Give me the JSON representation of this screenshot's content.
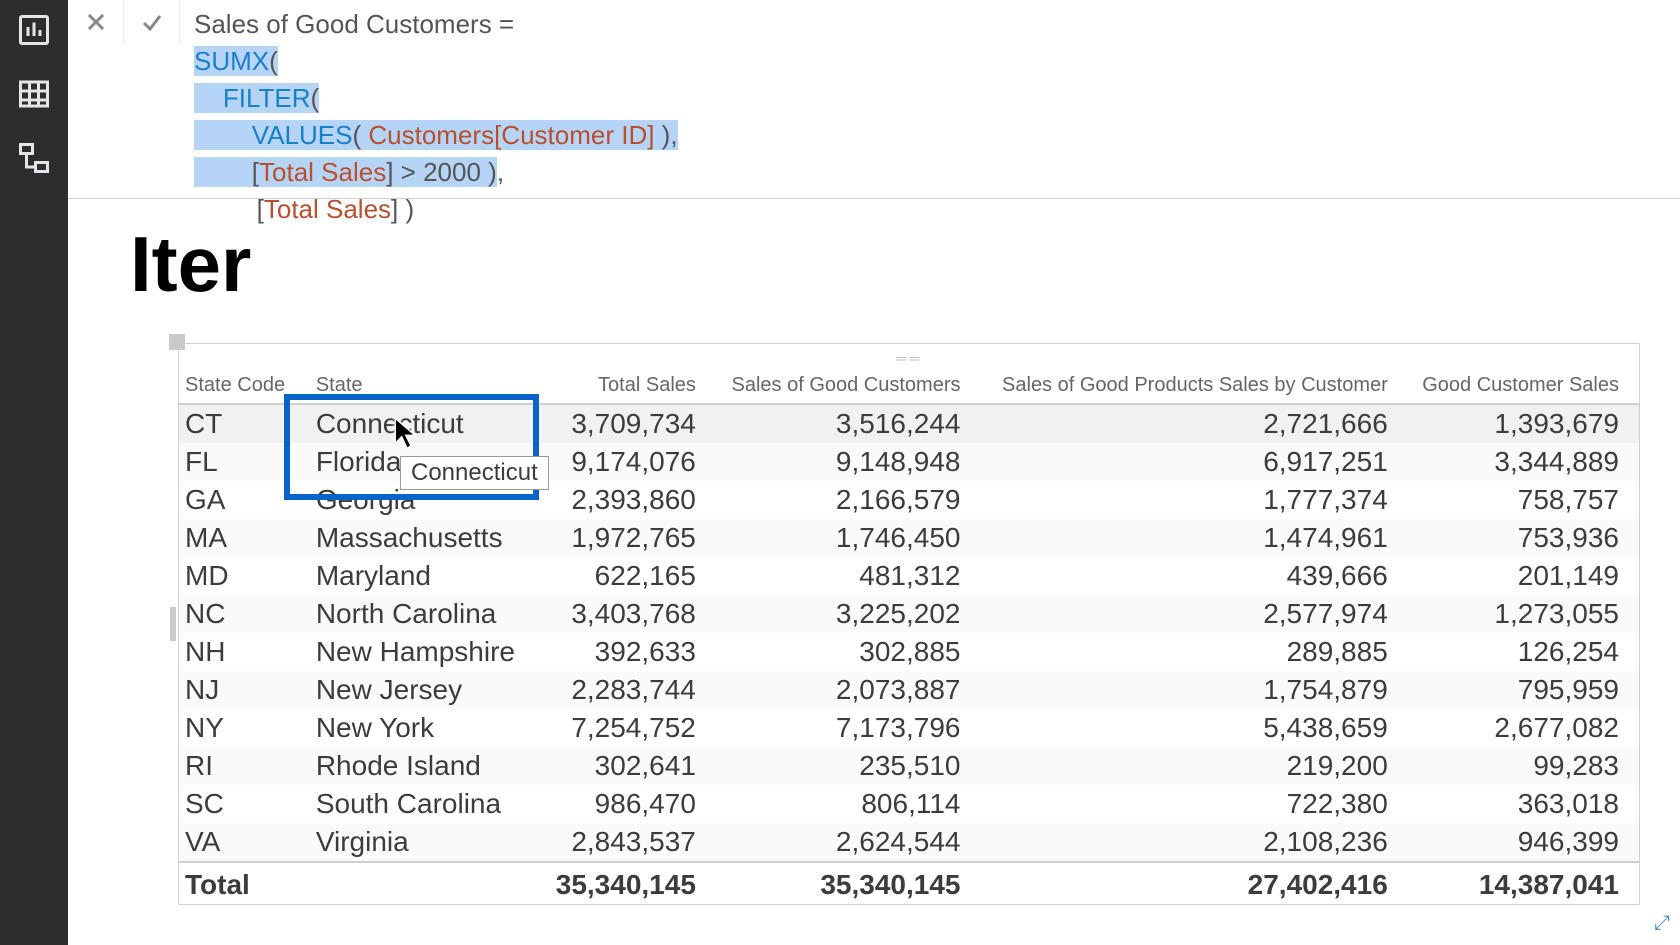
{
  "nav": {
    "items": [
      "report-view",
      "data-view",
      "model-view"
    ]
  },
  "formula": {
    "measure_name": "Sales of Good Customers",
    "func_sumx": "SUMX",
    "func_filter": "FILTER",
    "func_values": "VALUES",
    "col_ref": "Customers[Customer ID]",
    "measure_ref": "Total Sales",
    "threshold": "2000",
    "cancel_label": "✕",
    "accept_label": "✓"
  },
  "page": {
    "title": "Iter"
  },
  "table": {
    "headers": [
      "State Code",
      "State",
      "Total Sales",
      "Sales of Good Customers",
      "Sales of Good Products Sales by Customer",
      "Good Customer Sales"
    ],
    "rows": [
      {
        "code": "CT",
        "state": "Connecticut",
        "total": "3,709,734",
        "good_cust": "3,516,244",
        "good_prod": "2,721,666",
        "gcs": "1,393,679"
      },
      {
        "code": "FL",
        "state": "Florida",
        "total": "9,174,076",
        "good_cust": "9,148,948",
        "good_prod": "6,917,251",
        "gcs": "3,344,889"
      },
      {
        "code": "GA",
        "state": "Georgia",
        "total": "2,393,860",
        "good_cust": "2,166,579",
        "good_prod": "1,777,374",
        "gcs": "758,757"
      },
      {
        "code": "MA",
        "state": "Massachusetts",
        "total": "1,972,765",
        "good_cust": "1,746,450",
        "good_prod": "1,474,961",
        "gcs": "753,936"
      },
      {
        "code": "MD",
        "state": "Maryland",
        "total": "622,165",
        "good_cust": "481,312",
        "good_prod": "439,666",
        "gcs": "201,149"
      },
      {
        "code": "NC",
        "state": "North Carolina",
        "total": "3,403,768",
        "good_cust": "3,225,202",
        "good_prod": "2,577,974",
        "gcs": "1,273,055"
      },
      {
        "code": "NH",
        "state": "New Hampshire",
        "total": "392,633",
        "good_cust": "302,885",
        "good_prod": "289,885",
        "gcs": "126,254"
      },
      {
        "code": "NJ",
        "state": "New Jersey",
        "total": "2,283,744",
        "good_cust": "2,073,887",
        "good_prod": "1,754,879",
        "gcs": "795,959"
      },
      {
        "code": "NY",
        "state": "New York",
        "total": "7,254,752",
        "good_cust": "7,173,796",
        "good_prod": "5,438,659",
        "gcs": "2,677,082"
      },
      {
        "code": "RI",
        "state": "Rhode Island",
        "total": "302,641",
        "good_cust": "235,510",
        "good_prod": "219,200",
        "gcs": "99,283"
      },
      {
        "code": "SC",
        "state": "South Carolina",
        "total": "986,470",
        "good_cust": "806,114",
        "good_prod": "722,380",
        "gcs": "363,018"
      },
      {
        "code": "VA",
        "state": "Virginia",
        "total": "2,843,537",
        "good_cust": "2,624,544",
        "good_prod": "2,108,236",
        "gcs": "946,399"
      }
    ],
    "total_row": {
      "label": "Total",
      "total": "35,340,145",
      "good_cust": "35,340,145",
      "good_prod": "27,402,416",
      "gcs": "14,387,041"
    }
  },
  "tooltip": {
    "text": "Connecticut"
  }
}
